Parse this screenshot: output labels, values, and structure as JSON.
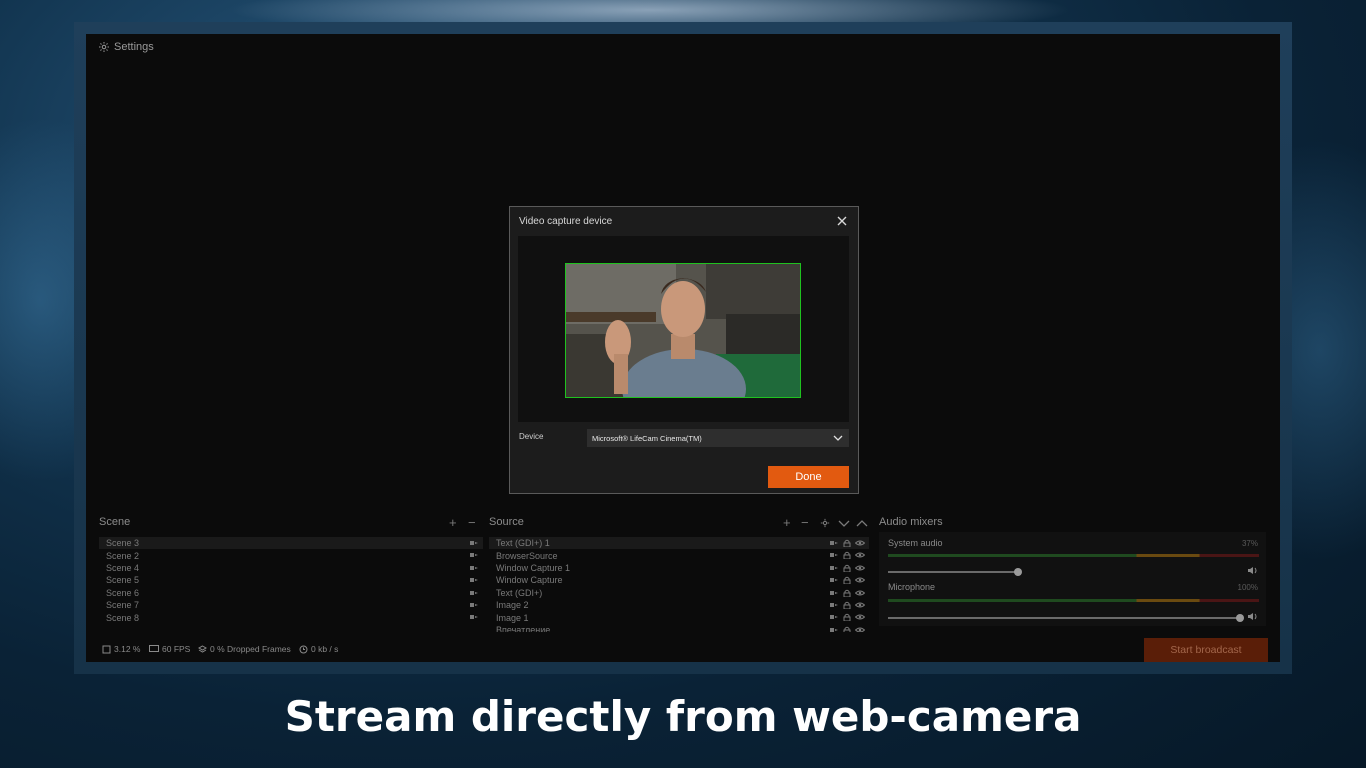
{
  "app": {
    "settings_label": "Settings"
  },
  "dialog": {
    "title": "Video capture device",
    "device_label": "Device",
    "device_value": "Microsoft® LifeCam Cinema(TM)",
    "done_label": "Done"
  },
  "scene_panel": {
    "title": "Scene",
    "items": [
      {
        "label": "Scene 3",
        "selected": true
      },
      {
        "label": "Scene 2"
      },
      {
        "label": "Scene 4"
      },
      {
        "label": "Scene 5"
      },
      {
        "label": "Scene 6"
      },
      {
        "label": "Scene 7"
      },
      {
        "label": "Scene 8"
      }
    ]
  },
  "source_panel": {
    "title": "Source",
    "items": [
      {
        "label": "Text (GDI+) 1",
        "selected": true
      },
      {
        "label": "BrowserSource"
      },
      {
        "label": "Window Capture 1"
      },
      {
        "label": "Window Capture"
      },
      {
        "label": "Text (GDI+)"
      },
      {
        "label": "Image 2"
      },
      {
        "label": "Image 1"
      },
      {
        "label": "Впечатление"
      }
    ]
  },
  "audio_panel": {
    "title": "Audio mixers",
    "channels": [
      {
        "label": "System audio",
        "percent": "37%",
        "level": 0.37
      },
      {
        "label": "Microphone",
        "percent": "100%",
        "level": 1.0
      }
    ]
  },
  "status_bar": {
    "cpu": "3.12 %",
    "fps": "60 FPS",
    "dropped": "0 % Dropped Frames",
    "bitrate": "0 kb / s"
  },
  "start_broadcast_label": "Start broadcast",
  "caption": "Stream directly from web-camera",
  "colors": {
    "accent": "#e25a10",
    "preview_border": "#1fc21f",
    "start_broadcast_bg": "#5a1e08"
  }
}
